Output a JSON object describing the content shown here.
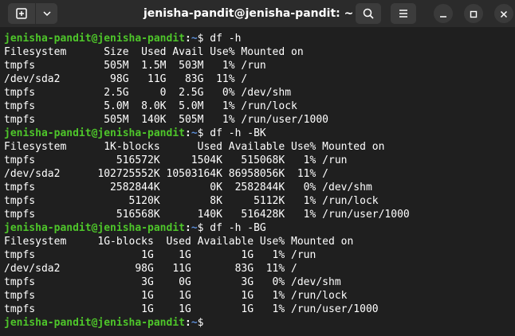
{
  "window": {
    "title": "jenisha-pandit@jenisha-pandit: ~"
  },
  "icons": {
    "new_tab": "new-tab-icon",
    "tab_menu": "chevron-down-icon",
    "search": "search-icon",
    "menu": "hamburger-menu-icon",
    "minimize": "minimize-icon",
    "maximize": "maximize-icon",
    "close": "close-icon"
  },
  "colors": {
    "prompt_user": "#4ec62a",
    "prompt_path": "#5c8dd6",
    "text": "#ffffff",
    "background": "#1f1f1f"
  },
  "terminal": {
    "lines": [
      {
        "type": "prompt",
        "user": "jenisha-pandit@jenisha-pandit",
        "path": "~",
        "command": "$ df -h"
      },
      {
        "type": "output",
        "text": "Filesystem      Size  Used Avail Use% Mounted on"
      },
      {
        "type": "output",
        "text": "tmpfs           505M  1.5M  503M   1% /run"
      },
      {
        "type": "output",
        "text": "/dev/sda2        98G   11G   83G  11% /"
      },
      {
        "type": "output",
        "text": "tmpfs           2.5G     0  2.5G   0% /dev/shm"
      },
      {
        "type": "output",
        "text": "tmpfs           5.0M  8.0K  5.0M   1% /run/lock"
      },
      {
        "type": "output",
        "text": "tmpfs           505M  140K  505M   1% /run/user/1000"
      },
      {
        "type": "prompt",
        "user": "jenisha-pandit@jenisha-pandit",
        "path": "~",
        "command": "$ df -h -BK"
      },
      {
        "type": "output",
        "text": "Filesystem      1K-blocks      Used Available Use% Mounted on"
      },
      {
        "type": "output",
        "text": "tmpfs             516572K     1504K   515068K   1% /run"
      },
      {
        "type": "output",
        "text": "/dev/sda2      102725552K 10503164K 86958056K  11% /"
      },
      {
        "type": "output",
        "text": "tmpfs            2582844K        0K  2582844K   0% /dev/shm"
      },
      {
        "type": "output",
        "text": "tmpfs               5120K        8K     5112K   1% /run/lock"
      },
      {
        "type": "output",
        "text": "tmpfs             516568K      140K   516428K   1% /run/user/1000"
      },
      {
        "type": "prompt",
        "user": "jenisha-pandit@jenisha-pandit",
        "path": "~",
        "command": "$ df -h -BG"
      },
      {
        "type": "output",
        "text": "Filesystem     1G-blocks  Used Available Use% Mounted on"
      },
      {
        "type": "output",
        "text": "tmpfs                 1G    1G        1G   1% /run"
      },
      {
        "type": "output",
        "text": "/dev/sda2            98G   11G       83G  11% /"
      },
      {
        "type": "output",
        "text": "tmpfs                 3G    0G        3G   0% /dev/shm"
      },
      {
        "type": "output",
        "text": "tmpfs                 1G    1G        1G   1% /run/lock"
      },
      {
        "type": "output",
        "text": "tmpfs                 1G    1G        1G   1% /run/user/1000"
      },
      {
        "type": "prompt",
        "user": "jenisha-pandit@jenisha-pandit",
        "path": "~",
        "command": "$ "
      }
    ]
  }
}
